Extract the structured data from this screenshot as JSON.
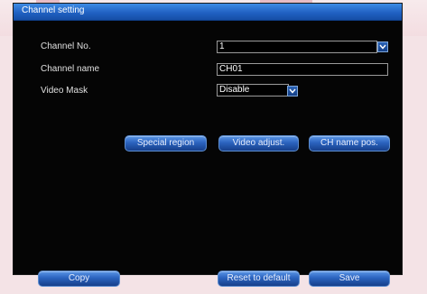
{
  "window": {
    "title": "Channel setting"
  },
  "form": {
    "channel_no": {
      "label": "Channel No.",
      "value": "1"
    },
    "channel_name": {
      "label": "Channel name",
      "value": "CH01"
    },
    "video_mask": {
      "label": "Video Mask",
      "value": "Disable"
    }
  },
  "buttons": {
    "special_region": "Special region",
    "video_adjust": "Video adjust.",
    "ch_name_pos": "CH name pos.",
    "copy": "Copy",
    "reset": "Reset to default",
    "save": "Save"
  },
  "colors": {
    "title_bar": "#2a6fd0",
    "panel_bg": "#050505",
    "button": "#2b63bf"
  }
}
